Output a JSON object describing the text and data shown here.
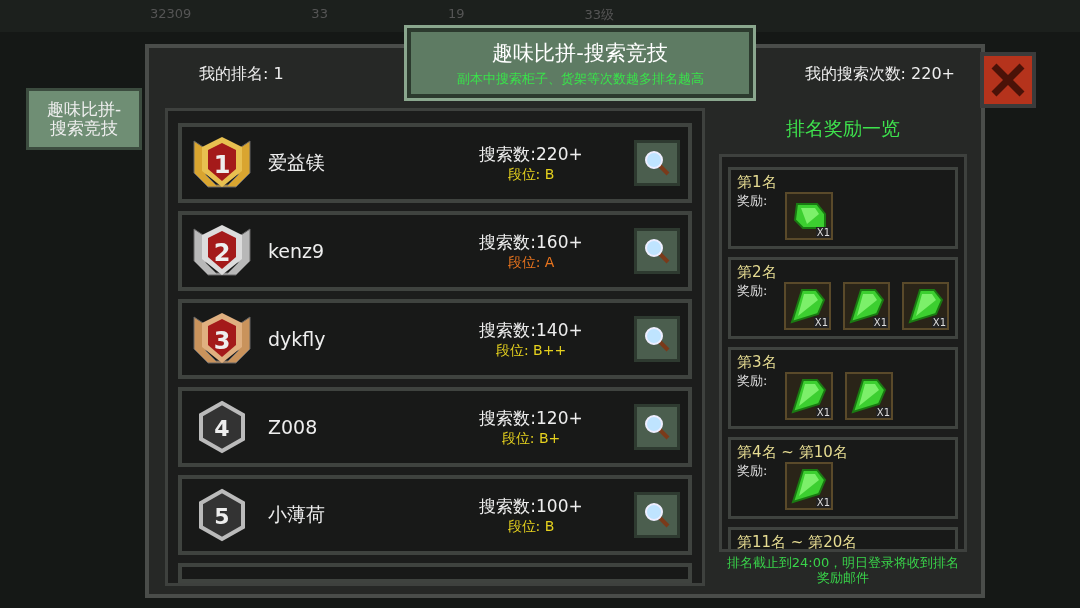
{
  "hud": [
    "32309",
    "33",
    "19",
    "33级"
  ],
  "side_tab": {
    "label": "趣味比拼-搜索竞技",
    "selected": true
  },
  "title": "趣味比拼-搜索竞技",
  "subtitle": "副本中搜索柜子、货架等次数越多排名越高",
  "my_rank": "我的排名: 1",
  "my_searches": "我的搜索次数: 220+",
  "rankings": [
    {
      "rank": "1",
      "kind": "gold",
      "name": "爱益镁",
      "searches": "搜索数:220+",
      "tier": "段位: B",
      "color": "#e6d21e"
    },
    {
      "rank": "2",
      "kind": "silver",
      "name": "kenz9",
      "searches": "搜索数:160+",
      "tier": "段位: A",
      "color": "#e8741e"
    },
    {
      "rank": "3",
      "kind": "bronze",
      "name": "dykfly",
      "searches": "搜索数:140+",
      "tier": "段位: B++",
      "color": "#e6d21e"
    },
    {
      "rank": "4",
      "kind": "plain",
      "name": "Z008",
      "searches": "搜索数:120+",
      "tier": "段位: B+",
      "color": "#e6d21e"
    },
    {
      "rank": "5",
      "kind": "plain",
      "name": "小薄荷",
      "searches": "搜索数:100+",
      "tier": "段位: B",
      "color": "#e6d21e"
    }
  ],
  "rewards_title": "排名奖励一览",
  "rewards": [
    {
      "place": "第1名",
      "label": "奖励:",
      "items": [
        {
          "kind": "round",
          "count": "X1"
        }
      ]
    },
    {
      "place": "第2名",
      "label": "奖励:",
      "items": [
        {
          "kind": "shard",
          "count": "X1"
        },
        {
          "kind": "shard",
          "count": "X1"
        },
        {
          "kind": "shard",
          "count": "X1"
        }
      ]
    },
    {
      "place": "第3名",
      "label": "奖励:",
      "items": [
        {
          "kind": "shard",
          "count": "X1"
        },
        {
          "kind": "shard",
          "count": "X1"
        }
      ]
    },
    {
      "place": "第4名 ~ 第10名",
      "label": "奖励:",
      "items": [
        {
          "kind": "shard",
          "count": "X1"
        }
      ]
    },
    {
      "place": "第11名 ~ 第20名"
    }
  ],
  "footer": "排名截止到24:00，明日登录将收到排名奖励邮件"
}
